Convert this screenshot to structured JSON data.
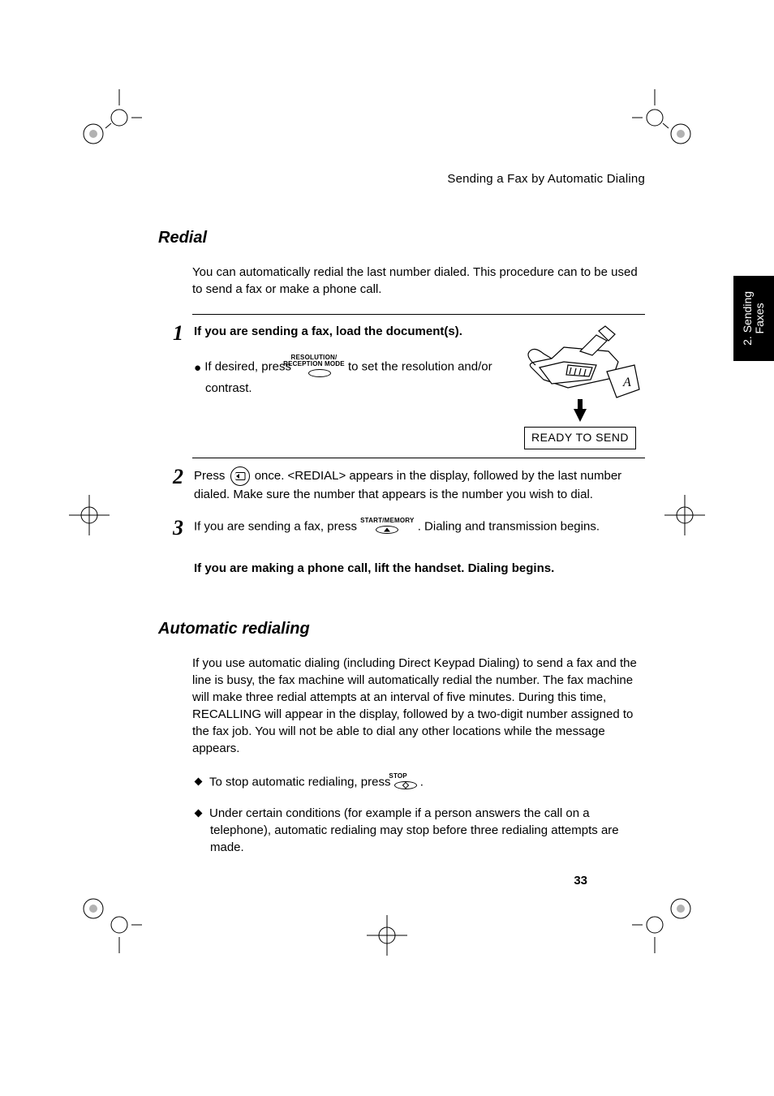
{
  "running_head": "Sending a Fax by Automatic Dialing",
  "side_tab": {
    "line1": "2. Sending",
    "line2": "Faxes"
  },
  "page_number": "33",
  "sections": {
    "redial": {
      "title": "Redial",
      "intro": "You can automatically redial the last number dialed. This procedure can to be used to send a fax or make a phone call.",
      "steps": [
        {
          "num": "1",
          "bold": "If you are sending a fax, load the document(s).",
          "sub_prefix": "If desired, press",
          "button_top": "RESOLUTION/",
          "button_bot": "RECEPTION MODE",
          "sub_suffix": "to set the resolution and/or contrast.",
          "display_text": "READY TO SEND"
        },
        {
          "num": "2",
          "prefix": "Press",
          "suffix": "once. <REDIAL> appears in the display, followed by the last number dialed. Make sure the number that appears is the number you wish to dial."
        },
        {
          "num": "3",
          "prefix": "If you are sending a fax, press",
          "button_top": "START/MEMORY",
          "suffix": ". Dialing and transmission begins.",
          "alt": "If you are making a phone call, lift the handset. Dialing begins."
        }
      ]
    },
    "auto": {
      "title": "Automatic redialing",
      "intro": "If you use automatic dialing (including Direct Keypad Dialing) to send a fax and the line is busy, the fax machine will automatically redial the number. The fax machine will make three redial attempts at an interval of five minutes. During this time, RECALLING will appear in the display, followed by a two-digit number assigned to the fax job. You will not be able to dial any other locations while the message appears.",
      "bullets": [
        {
          "prefix": "To stop automatic redialing, press",
          "button_top": "STOP",
          "suffix": "."
        },
        {
          "text": "Under certain conditions (for example if a person answers the call on a telephone), automatic redialing may stop before three redialing attempts are made."
        }
      ]
    }
  }
}
